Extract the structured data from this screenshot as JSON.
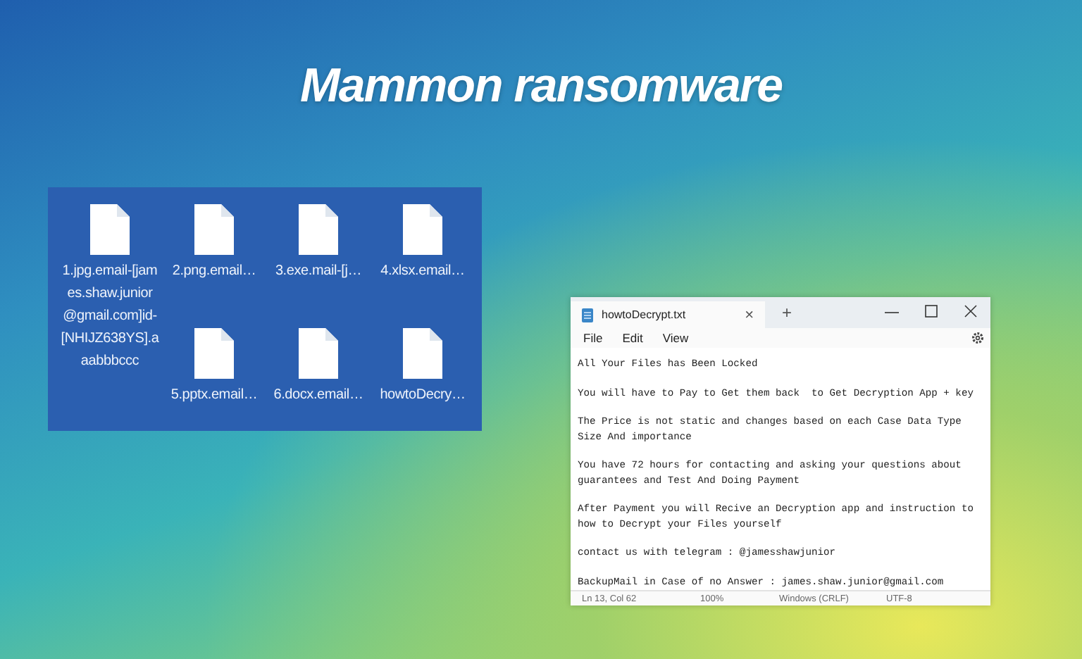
{
  "title": "Mammon ransomware",
  "files": [
    {
      "name": "1.jpg.email-[james.shaw.junior@gmail.com]id-[NHIJZ638YS].aaabbbccc"
    },
    {
      "name": "2.png.email…"
    },
    {
      "name": "3.exe.mail-[j…"
    },
    {
      "name": "4.xlsx.email…"
    },
    {
      "name": "5.pptx.email…"
    },
    {
      "name": "6.docx.email…"
    },
    {
      "name": "howtoDecry…"
    }
  ],
  "notepad": {
    "tab": {
      "label": "howtoDecrypt.txt",
      "close": "×",
      "new": "+"
    },
    "menu": [
      "File",
      "Edit",
      "View"
    ],
    "paragraphs": [
      [
        "All Your Files has Been Locked"
      ],
      [
        "You will have to Pay to Get them back  to Get Decryption App + key"
      ],
      [
        "The Price is not static and changes based on each Case Data Type",
        "Size And importance"
      ],
      [
        "You have 72 hours for contacting and asking your questions about",
        "guarantees and Test And Doing Payment"
      ],
      [
        "After Payment you will Recive an Decryption app and instruction to",
        "how to Decrypt your Files yourself"
      ],
      [
        "contact us with telegram : @jamesshawjunior"
      ],
      [
        "BackupMail in Case of no Answer : james.shaw.junior@gmail.com"
      ]
    ],
    "status": [
      "Ln 13, Col 62",
      "100%",
      "Windows (CRLF)",
      "UTF-8"
    ]
  }
}
